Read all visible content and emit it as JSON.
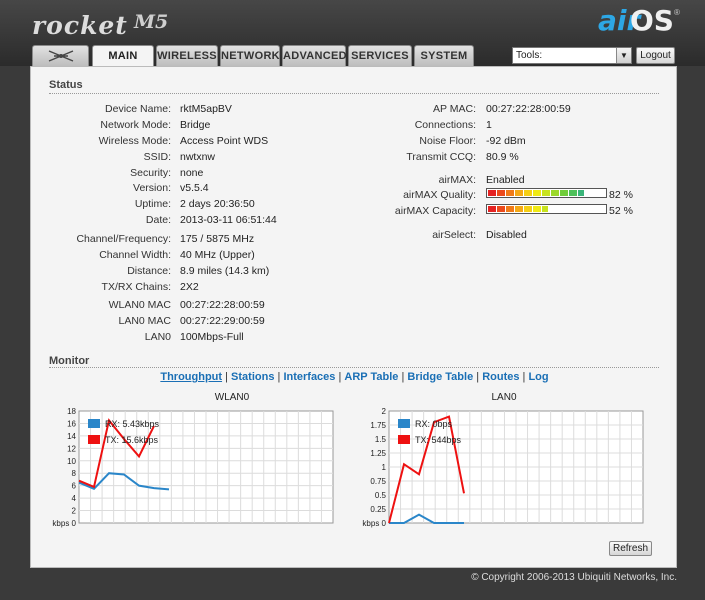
{
  "brand": {
    "product": "rocket",
    "model": "M5",
    "os_air": "air",
    "os_os": "OS",
    "tm": "®"
  },
  "tabs": [
    "MAIN",
    "WIRELESS",
    "NETWORK",
    "ADVANCED",
    "SERVICES",
    "SYSTEM"
  ],
  "tools": {
    "selected": "Tools:",
    "logout": "Logout"
  },
  "status": {
    "title": "Status",
    "left": [
      {
        "label": "Device Name:",
        "value": "rktM5apBV"
      },
      {
        "label": "Network Mode:",
        "value": "Bridge"
      },
      {
        "label": "Wireless Mode:",
        "value": "Access Point WDS"
      },
      {
        "label": "SSID:",
        "value": "nwtxnw"
      },
      {
        "label": "Security:",
        "value": "none"
      },
      {
        "label": "Version:",
        "value": "v5.5.4"
      },
      {
        "label": "Uptime:",
        "value": "2 days 20:36:50"
      },
      {
        "label": "Date:",
        "value": "2013-03-11 06:51:44"
      },
      {
        "label": "Channel/Frequency:",
        "value": "175 / 5875 MHz"
      },
      {
        "label": "Channel Width:",
        "value": "40 MHz (Upper)"
      },
      {
        "label": "Distance:",
        "value": "8.9 miles (14.3 km)"
      },
      {
        "label": "TX/RX Chains:",
        "value": "2X2"
      },
      {
        "label": "WLAN0 MAC",
        "value": "00:27:22:28:00:59"
      },
      {
        "label": "LAN0 MAC",
        "value": "00:27:22:29:00:59"
      },
      {
        "label": "LAN0",
        "value": "100Mbps-Full"
      }
    ],
    "right": [
      {
        "label": "AP MAC:",
        "value": "00:27:22:28:00:59"
      },
      {
        "label": "Connections:",
        "value": "1"
      },
      {
        "label": "Noise Floor:",
        "value": "-92 dBm"
      },
      {
        "label": "Transmit CCQ:",
        "value": "80.9 %"
      },
      {
        "label": "airMAX:",
        "value": "Enabled"
      },
      {
        "label": "airMAX Quality:",
        "value": "82 %"
      },
      {
        "label": "airMAX Capacity:",
        "value": "52 %"
      },
      {
        "label": "airSelect:",
        "value": "Disabled"
      }
    ],
    "meters": {
      "quality": 0.82,
      "capacity": 0.52
    }
  },
  "monitor": {
    "title": "Monitor",
    "links": [
      "Throughput",
      "Stations",
      "Interfaces",
      "ARP Table",
      "Bridge Table",
      "Routes",
      "Log"
    ],
    "separator": " | ",
    "refresh": "Refresh"
  },
  "chart_data": [
    {
      "type": "line",
      "title": "WLAN0",
      "ylabel": "kbps",
      "ylim": [
        0,
        18
      ],
      "yticks": [
        0,
        2,
        4,
        6,
        8,
        10,
        12,
        14,
        16,
        18
      ],
      "series": [
        {
          "name": "RX: 5.43kbps",
          "color": "#2a86c9",
          "values": [
            6.5,
            5.5,
            8.0,
            7.8,
            6.0,
            5.6,
            5.4
          ]
        },
        {
          "name": "TX: 15.6kbps",
          "color": "#ee1111",
          "values": [
            6.8,
            5.8,
            16.5,
            13.5,
            10.7,
            15.6
          ]
        }
      ]
    },
    {
      "type": "line",
      "title": "LAN0",
      "ylabel": "kbps",
      "ylim": [
        0,
        2
      ],
      "yticks": [
        0,
        0.25,
        0.5,
        0.75,
        1,
        1.25,
        1.5,
        1.75,
        2
      ],
      "series": [
        {
          "name": "RX: 0bps",
          "color": "#2a86c9",
          "values": [
            0,
            0,
            0.15,
            0,
            0,
            0
          ]
        },
        {
          "name": "TX: 544bps",
          "color": "#ee1111",
          "values": [
            0,
            1.05,
            0.87,
            1.8,
            1.9,
            0.53
          ]
        }
      ]
    }
  ],
  "footer": "© Copyright 2006-2013 Ubiquiti Networks, Inc."
}
